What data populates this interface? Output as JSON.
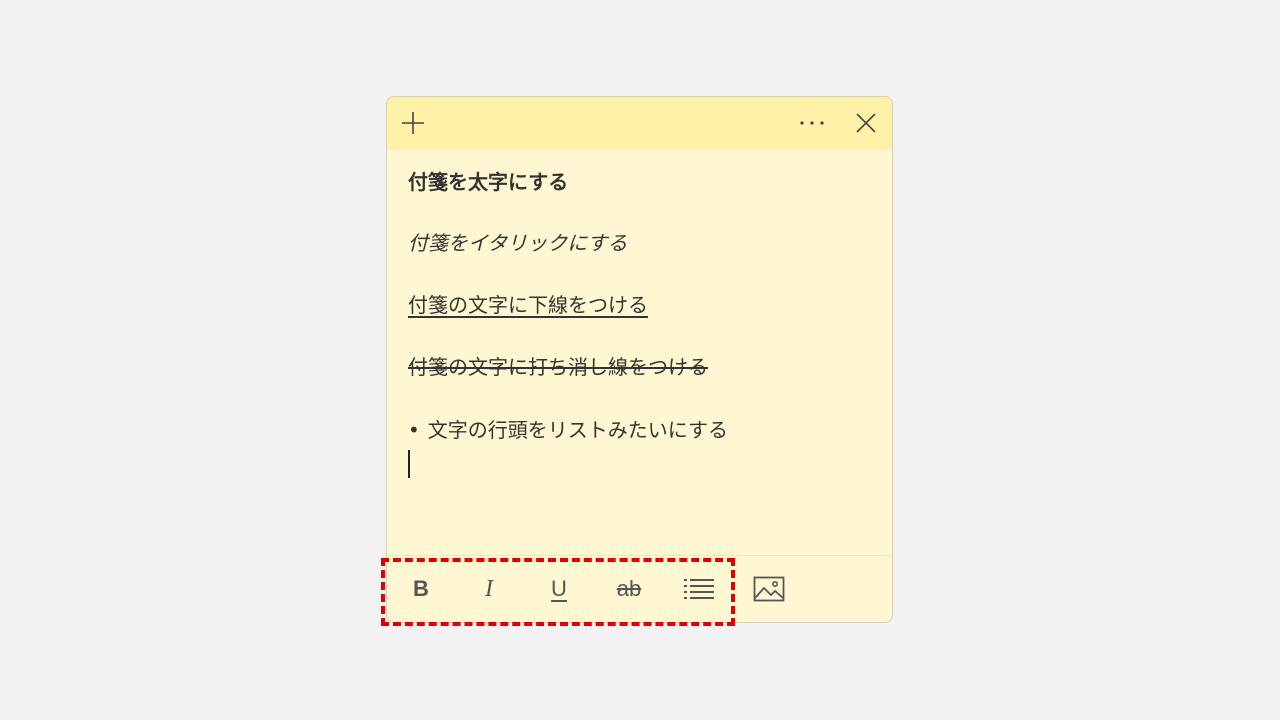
{
  "note": {
    "lines": {
      "bold": "付箋を太字にする",
      "italic": "付箋をイタリックにする",
      "underline": "付箋の文字に下線をつける",
      "strike": "付箋の文字に打ち消し線をつける",
      "bullet_symbol": "•",
      "bullet": "文字の行頭をリストみたいにする"
    }
  },
  "toolbar": {
    "bold_label": "B",
    "italic_label": "I",
    "underline_label": "U",
    "strike_label": "ab"
  },
  "colors": {
    "note_background": "#fff7d1",
    "titlebar_background": "#fff1a8",
    "highlight_border": "#e00000"
  },
  "icons": {
    "add": "plus-icon",
    "more": "more-icon",
    "close": "close-icon",
    "list": "bullet-list-icon",
    "image": "image-icon"
  }
}
